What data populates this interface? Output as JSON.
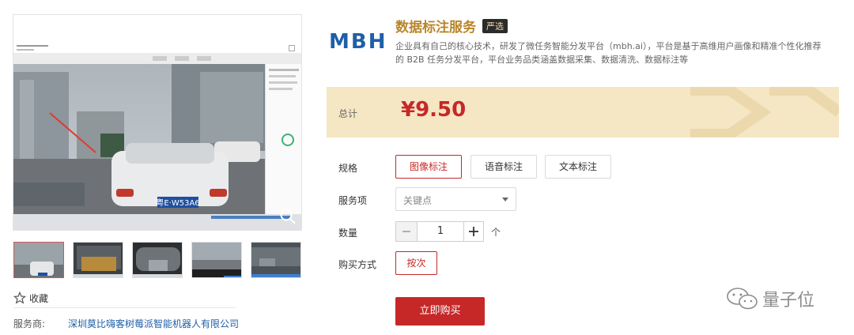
{
  "gallery": {
    "favorite_label": "收藏",
    "provider_label": "服务商:",
    "provider_name": "深圳莫比嗨客树莓派智能机器人有限公司",
    "plate_text": "粤E·W53A6"
  },
  "product": {
    "logo_text": "MBH",
    "title": "数据标注服务",
    "badge": "严选",
    "description_line1": "企业具有自己的核心技术，研发了微任务智能分发平台（mbh.ai），平台是基于高维用户画像和精准个性化推荐",
    "description_line2": "的 B2B 任务分发平台，平台业务品类涵盖数据采集、数据清洗、数据标注等"
  },
  "price": {
    "label": "总计",
    "value": "¥9.50"
  },
  "options": {
    "spec_label": "规格",
    "spec_items": [
      "图像标注",
      "语音标注",
      "文本标注"
    ],
    "service_label": "服务项",
    "service_selected": "关键点",
    "quantity_label": "数量",
    "quantity_value": "1",
    "quantity_unit": "个",
    "buy_mode_label": "购买方式",
    "buy_mode_value": "按次",
    "buy_button": "立即购买"
  },
  "watermark": {
    "text": "量子位"
  },
  "colors": {
    "accent": "#c62828",
    "title_gold": "#b8862b",
    "price_band": "#f5e6c4",
    "logo_blue": "#1f5fa8"
  }
}
